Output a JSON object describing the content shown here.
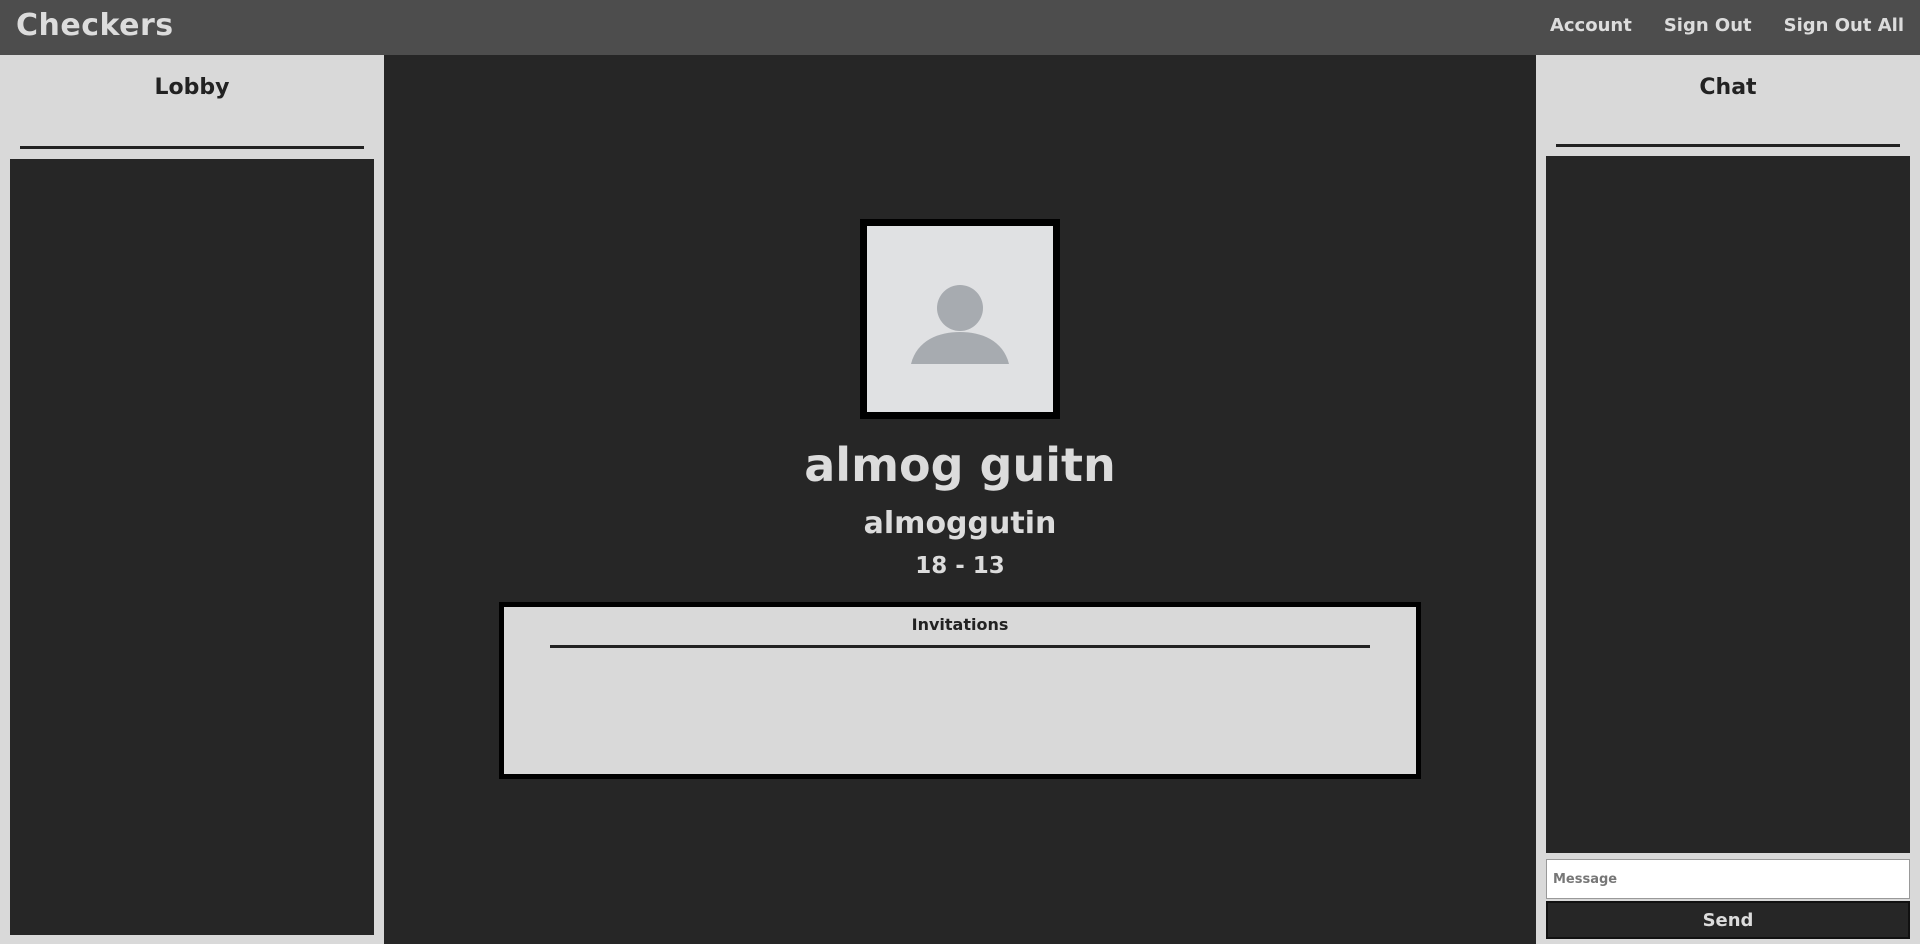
{
  "header": {
    "brand": "Checkers",
    "nav": {
      "account": "Account",
      "sign_out": "Sign Out",
      "sign_out_all": "Sign Out All"
    }
  },
  "lobby": {
    "title": "Lobby",
    "users": []
  },
  "profile": {
    "avatar_icon": "user-silhouette-icon",
    "full_name": "almog guitn",
    "username": "almoggutin",
    "record": "18 - 13",
    "invitations_title": "Invitations",
    "invitations": []
  },
  "chat": {
    "title": "Chat",
    "messages": [],
    "input_placeholder": "Message",
    "send_label": "Send"
  },
  "colors": {
    "background": "#262626",
    "topbar": "#4d4d4d",
    "panel": "#d9d9d9",
    "text_light": "#dcdcdc",
    "avatar_bg": "#e0e1e3",
    "avatar_icon": "#a7abb0"
  }
}
